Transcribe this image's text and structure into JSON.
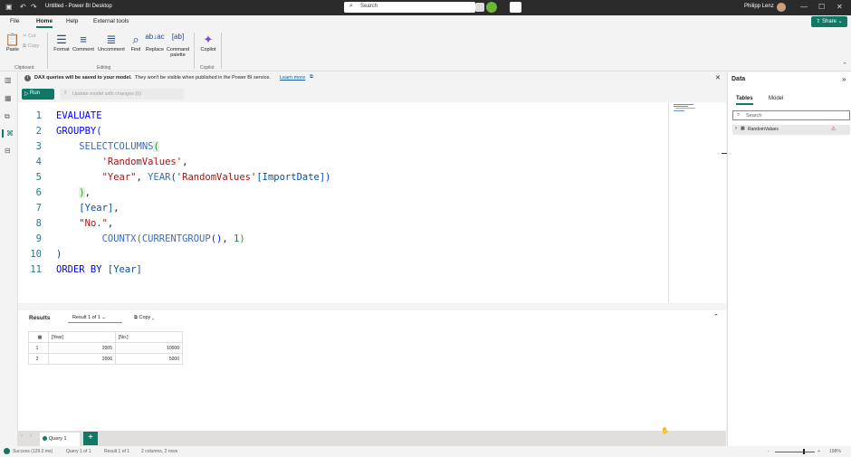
{
  "titlebar": {
    "title": "Untitled - Power BI Desktop",
    "search_placeholder": "Search",
    "user_name": "Philipp Lenz"
  },
  "menu": {
    "file": "File",
    "home": "Home",
    "help": "Help",
    "external_tools": "External tools",
    "share": "Share"
  },
  "ribbon": {
    "paste": "Paste",
    "cut": "Cut",
    "copy": "Copy",
    "format": "Format",
    "comment": "Comment",
    "uncomment": "Uncomment",
    "find": "Find",
    "replace": "Replace",
    "command_palette": "Command palette",
    "copilot": "Copilot",
    "groups": {
      "clipboard": "Clipboard",
      "editing": "Editing",
      "copilot": "Copilot"
    }
  },
  "infobar": {
    "message_bold": "DAX queries will be saved to your model.",
    "message": "They won't be visible when published in the Power BI service.",
    "link": "Learn more"
  },
  "runbar": {
    "run": "Run",
    "update": "Update model with changes (0)"
  },
  "editor": {
    "line_numbers": [
      "1",
      "2",
      "3",
      "4",
      "5",
      "6",
      "7",
      "8",
      "9",
      "10",
      "11"
    ]
  },
  "results": {
    "label": "Results",
    "selector": "Result 1 of 1",
    "copy": "Copy",
    "columns": [
      "[Year]",
      "[No.]"
    ],
    "rows": [
      {
        "index": "1",
        "year": "2005",
        "no": "10000"
      },
      {
        "index": "2",
        "year": "2006",
        "no": "5000"
      }
    ]
  },
  "tabs": {
    "query": "Query 1",
    "add": "+"
  },
  "status": {
    "success": "Success (129.0 ms)",
    "query": "Query 1 of 1",
    "result": "Result 1 of 1",
    "shape": "2 columns, 2 rows",
    "zoom": "198%"
  },
  "data_pane": {
    "title": "Data",
    "tab_tables": "Tables",
    "tab_model": "Model",
    "search_placeholder": "Search",
    "table_name": "RandomValues"
  },
  "colors": {
    "accent": "#117865",
    "keyword": "#0000ff",
    "string": "#a31515"
  }
}
